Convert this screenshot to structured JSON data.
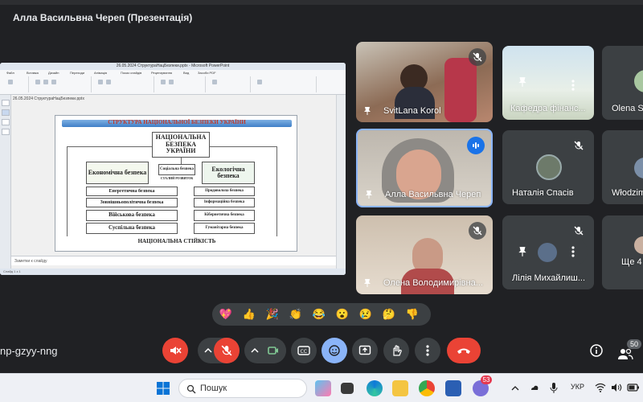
{
  "window": {
    "title": "Алла Васильвна Череп (Презентація)"
  },
  "presentation": {
    "app_title": "26.05.2024 СтруктураНацБезпеки.pptx - Microsoft PowerPoint",
    "ribbon_tabs": [
      "Файл",
      "Вставка",
      "Дизайн",
      "Переходи",
      "Анімація",
      "Показ слайдів",
      "Рецензування",
      "Вид",
      "Засоби PDF"
    ],
    "file_path": "26.05.2024 СтруктураНацБезпеки.pptx",
    "notes_placeholder": "Заметки к слайду",
    "status": "Слайд 1 з 1",
    "slide": {
      "heading": "СТРУКТУРА НАЦІОНАЛЬНОЇ БЕЗПЕКИ УКРАЇНИ",
      "center": "НАЦІОНАЛЬНА БЕЗПЕКА УКРАЇНИ",
      "left_main": "Економічна безпека",
      "mid_top": "Соціальна безпека",
      "mid_bottom": "СТАЛИЙ РОЗВИТОК",
      "right_main": "Екологічна безпека",
      "left_items": [
        "Енергетична безпека",
        "Зовнішньополітична безпека",
        "Військова безпека",
        "Суспільна безпека"
      ],
      "right_items": [
        "Продовольча безпека",
        "Інформаційна безпека",
        "Кібернетична безпека",
        "Гуманітарна безпека"
      ],
      "footer": "НАЦІОНАЛЬНА СТІЙКІСТЬ"
    }
  },
  "participants": [
    {
      "name": "SvitLana Korol",
      "muted": true
    },
    {
      "name": "Кафедра фінанс...",
      "muted": false
    },
    {
      "name": "Olena St",
      "muted": false
    },
    {
      "name": "Алла Васильвна Череп",
      "speaking": true
    },
    {
      "name": "Наталія Спасів",
      "muted": true
    },
    {
      "name": "Włodzim",
      "muted": false
    },
    {
      "name": "Олена Володимирівна...",
      "muted": true
    },
    {
      "name": "Лілія Михайлиш...",
      "muted": true
    },
    {
      "name": "Ще 4",
      "muted": false
    }
  ],
  "reactions": [
    "💖",
    "👍",
    "🎉",
    "👏",
    "😂",
    "😮",
    "😢",
    "🤔",
    "👎"
  ],
  "meeting": {
    "code": "np-gzyy-nng",
    "people_count": "50"
  },
  "taskbar": {
    "search_placeholder": "Пошук",
    "lang": "УКР",
    "notif_badge": "53"
  },
  "colors": {
    "bg": "#202124",
    "red": "#ea4335",
    "accent": "#8ab4f8"
  }
}
